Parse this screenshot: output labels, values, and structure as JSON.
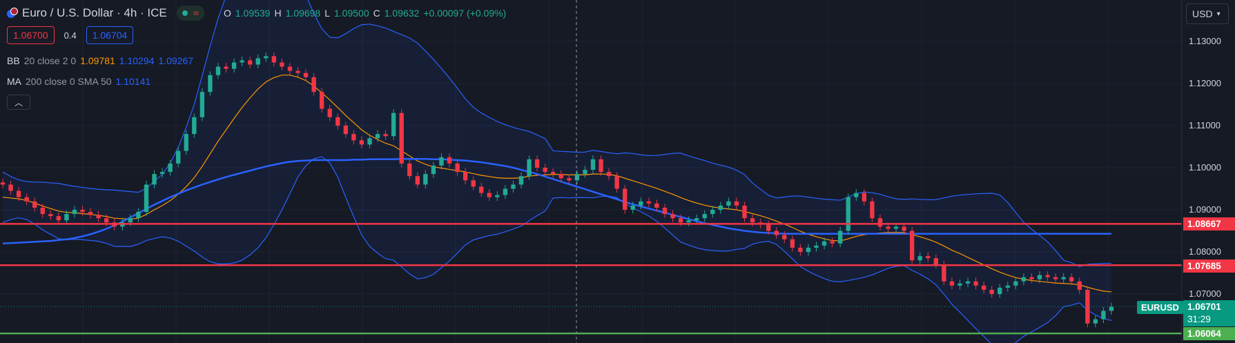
{
  "header": {
    "title": "Euro / U.S. Dollar · 4h · ICE",
    "ohlc": [
      {
        "key": "O",
        "value": "1.09539"
      },
      {
        "key": "H",
        "value": "1.09698"
      },
      {
        "key": "L",
        "value": "1.09500"
      },
      {
        "key": "C",
        "value": "1.09632"
      }
    ],
    "change": "+0.00097 (+0.09%)"
  },
  "trade": {
    "sell_price": "1.06700",
    "spread": "0.4",
    "buy_price": "1.06704"
  },
  "indicators": {
    "bb": {
      "name": "BB",
      "params": "20 close 2 0",
      "values": [
        "1.09781",
        "1.10294",
        "1.09267"
      ],
      "colors": [
        "#ff9800",
        "#2962ff",
        "#2962ff"
      ]
    },
    "ma": {
      "name": "MA",
      "params": "200 close 0 SMA 50",
      "value": "1.10141",
      "color": "#2962ff"
    }
  },
  "currency": {
    "label": "USD"
  },
  "price_axis": {
    "ticks": [
      "1.13000",
      "1.12000",
      "1.11000",
      "1.10000",
      "1.09000",
      "1.08000",
      "1.07000"
    ]
  },
  "price_tags": {
    "level_1": "1.08667",
    "level_2": "1.07685",
    "support": "1.06064",
    "symbol": "EURUSD",
    "current_price": "1.06701",
    "countdown": "31:29"
  },
  "colors": {
    "background": "#161a25",
    "up": "#22ab94",
    "down": "#f23645",
    "bb_basis": "#ff9800",
    "bb_band": "#2962ff",
    "ma": "#2962ff",
    "red_line": "#f23645",
    "green_line": "#4caf50"
  },
  "chart_data": {
    "type": "line",
    "title": "Euro / U.S. Dollar · 4h · ICE",
    "ylim": [
      1.058,
      1.138
    ],
    "y_ticks": [
      1.13,
      1.12,
      1.11,
      1.1,
      1.09,
      1.08,
      1.07
    ],
    "horizontal_levels": [
      {
        "value": 1.08667,
        "color": "#f23645"
      },
      {
        "value": 1.07685,
        "color": "#f23645"
      },
      {
        "value": 1.06064,
        "color": "#4caf50"
      }
    ],
    "current_price": 1.06701,
    "series": [
      {
        "name": "close",
        "values": [
          1.096,
          1.0945,
          1.093,
          1.092,
          1.0905,
          1.089,
          1.0885,
          1.0875,
          1.089,
          1.09,
          1.0895,
          1.0888,
          1.088,
          1.087,
          1.086,
          1.087,
          1.088,
          1.0895,
          1.096,
          1.0985,
          1.099,
          1.101,
          1.104,
          1.108,
          1.112,
          1.118,
          1.122,
          1.124,
          1.1235,
          1.125,
          1.1255,
          1.1245,
          1.126,
          1.1265,
          1.125,
          1.124,
          1.123,
          1.1225,
          1.1215,
          1.118,
          1.114,
          1.112,
          1.11,
          1.108,
          1.1065,
          1.1055,
          1.107,
          1.108,
          1.1075,
          1.113,
          1.101,
          1.098,
          1.096,
          1.0985,
          1.1005,
          1.1025,
          1.101,
          1.099,
          1.097,
          1.0955,
          1.094,
          1.093,
          1.0935,
          1.095,
          1.096,
          1.098,
          1.102,
          1.1,
          1.099,
          1.0985,
          1.0975,
          1.097,
          1.0985,
          1.0995,
          1.102,
          1.099,
          1.098,
          1.095,
          1.09,
          1.091,
          1.092,
          1.0915,
          1.0905,
          1.089,
          1.088,
          1.087,
          1.0875,
          1.088,
          1.089,
          1.09,
          1.091,
          1.092,
          1.091,
          1.088,
          1.087,
          1.0865,
          1.085,
          1.084,
          1.083,
          1.081,
          1.08,
          1.081,
          1.0815,
          1.0825,
          1.082,
          1.085,
          1.093,
          1.094,
          1.092,
          1.088,
          1.086,
          1.0855,
          1.086,
          1.085,
          1.078,
          1.079,
          1.0785,
          1.077,
          1.073,
          1.072,
          1.0725,
          1.073,
          1.072,
          1.071,
          1.07,
          1.0715,
          1.072,
          1.073,
          1.074,
          1.0735,
          1.0745,
          1.074,
          1.0735,
          1.074,
          1.073,
          1.071,
          1.063,
          1.064,
          1.066,
          1.067
        ]
      },
      {
        "name": "BB basis",
        "values": [
          1.093,
          1.0928,
          1.0926,
          1.0922,
          1.0916,
          1.0909,
          1.0903,
          1.0897,
          1.0894,
          1.0893,
          1.0891,
          1.0889,
          1.0887,
          1.0884,
          1.088,
          1.0879,
          1.0878,
          1.088,
          1.0889,
          1.09,
          1.091,
          1.0922,
          1.0937,
          1.0955,
          1.0976,
          1.1003,
          1.1033,
          1.1063,
          1.109,
          1.1117,
          1.1143,
          1.1166,
          1.1187,
          1.1204,
          1.1214,
          1.122,
          1.122,
          1.1215,
          1.1207,
          1.1194,
          1.1178,
          1.1161,
          1.1143,
          1.1124,
          1.1107,
          1.109,
          1.1077,
          1.1067,
          1.1058,
          1.1052,
          1.104,
          1.1028,
          1.1016,
          1.1008,
          1.1002,
          1.0999,
          1.0996,
          1.0993,
          1.099,
          1.0986,
          1.0982,
          1.0979,
          1.0976,
          1.0975,
          1.0975,
          1.0976,
          1.098,
          1.0982,
          1.0983,
          1.0984,
          1.0984,
          1.0983,
          1.0983,
          1.0983,
          1.0985,
          1.0985,
          1.0984,
          1.0981,
          1.0975,
          1.0969,
          1.0963,
          1.0957,
          1.0951,
          1.0944,
          1.0937,
          1.0929,
          1.0922,
          1.0916,
          1.0911,
          1.0907,
          1.0904,
          1.0902,
          1.09,
          1.0896,
          1.0891,
          1.0886,
          1.088,
          1.0873,
          1.0866,
          1.0858,
          1.0849,
          1.0842,
          1.0836,
          1.0831,
          1.0827,
          1.0826,
          1.0831,
          1.0837,
          1.0841,
          1.0843,
          1.0845,
          1.0846,
          1.0846,
          1.0846,
          1.0841,
          1.0836,
          1.083,
          1.0823,
          1.0814,
          1.0804,
          1.0796,
          1.0787,
          1.0778,
          1.0769,
          1.076,
          1.0752,
          1.0745,
          1.0739,
          1.0735,
          1.0732,
          1.073,
          1.0728,
          1.0726,
          1.0725,
          1.0724,
          1.0722,
          1.0716,
          1.0711,
          1.0707,
          1.0705
        ]
      },
      {
        "name": "MA 200",
        "values": [
          1.082,
          1.0821,
          1.0822,
          1.0823,
          1.0824,
          1.0825,
          1.0826,
          1.0828,
          1.083,
          1.0833,
          1.0837,
          1.0842,
          1.0848,
          1.0855,
          1.0863,
          1.0872,
          1.0882,
          1.0892,
          1.0902,
          1.0912,
          1.0921,
          1.093,
          1.0938,
          1.0946,
          1.0953,
          1.096,
          1.0966,
          1.0972,
          1.0978,
          1.0983,
          1.0988,
          1.0993,
          1.0998,
          1.1003,
          1.1007,
          1.1011,
          1.1014,
          1.1016,
          1.1017,
          1.1018,
          1.1018,
          1.1018,
          1.1018,
          1.1018,
          1.1019,
          1.1019,
          1.102,
          1.102,
          1.102,
          1.102,
          1.1021,
          1.1021,
          1.1021,
          1.1021,
          1.102,
          1.102,
          1.1019,
          1.1018,
          1.1017,
          1.1015,
          1.1013,
          1.101,
          1.1007,
          1.1004,
          1.1,
          1.0995,
          1.099,
          1.0985,
          1.0979,
          1.0973,
          1.0967,
          1.0961,
          1.0955,
          1.0949,
          1.0943,
          1.0937,
          1.0931,
          1.0925,
          1.0919,
          1.0913,
          1.0908,
          1.0903,
          1.0898,
          1.0893,
          1.0888,
          1.0883,
          1.0878,
          1.0873,
          1.0868,
          1.0864,
          1.086,
          1.0856,
          1.0853,
          1.085,
          1.0848,
          1.0846,
          1.0845,
          1.0844,
          1.0843,
          1.0843,
          1.0843,
          1.0843,
          1.0843,
          1.0843,
          1.0843,
          1.0843,
          1.0843,
          1.0843,
          1.0843,
          1.0843,
          1.0843,
          1.0843,
          1.0843,
          1.0843,
          1.0843,
          1.0843,
          1.0843,
          1.0843,
          1.0843,
          1.0843,
          1.0843,
          1.0843,
          1.0843,
          1.0843,
          1.0843,
          1.0843,
          1.0843,
          1.0843,
          1.0843,
          1.0843,
          1.0843,
          1.0843,
          1.0843,
          1.0843,
          1.0843,
          1.0843,
          1.0843,
          1.0843,
          1.0843,
          1.0843
        ]
      }
    ]
  }
}
